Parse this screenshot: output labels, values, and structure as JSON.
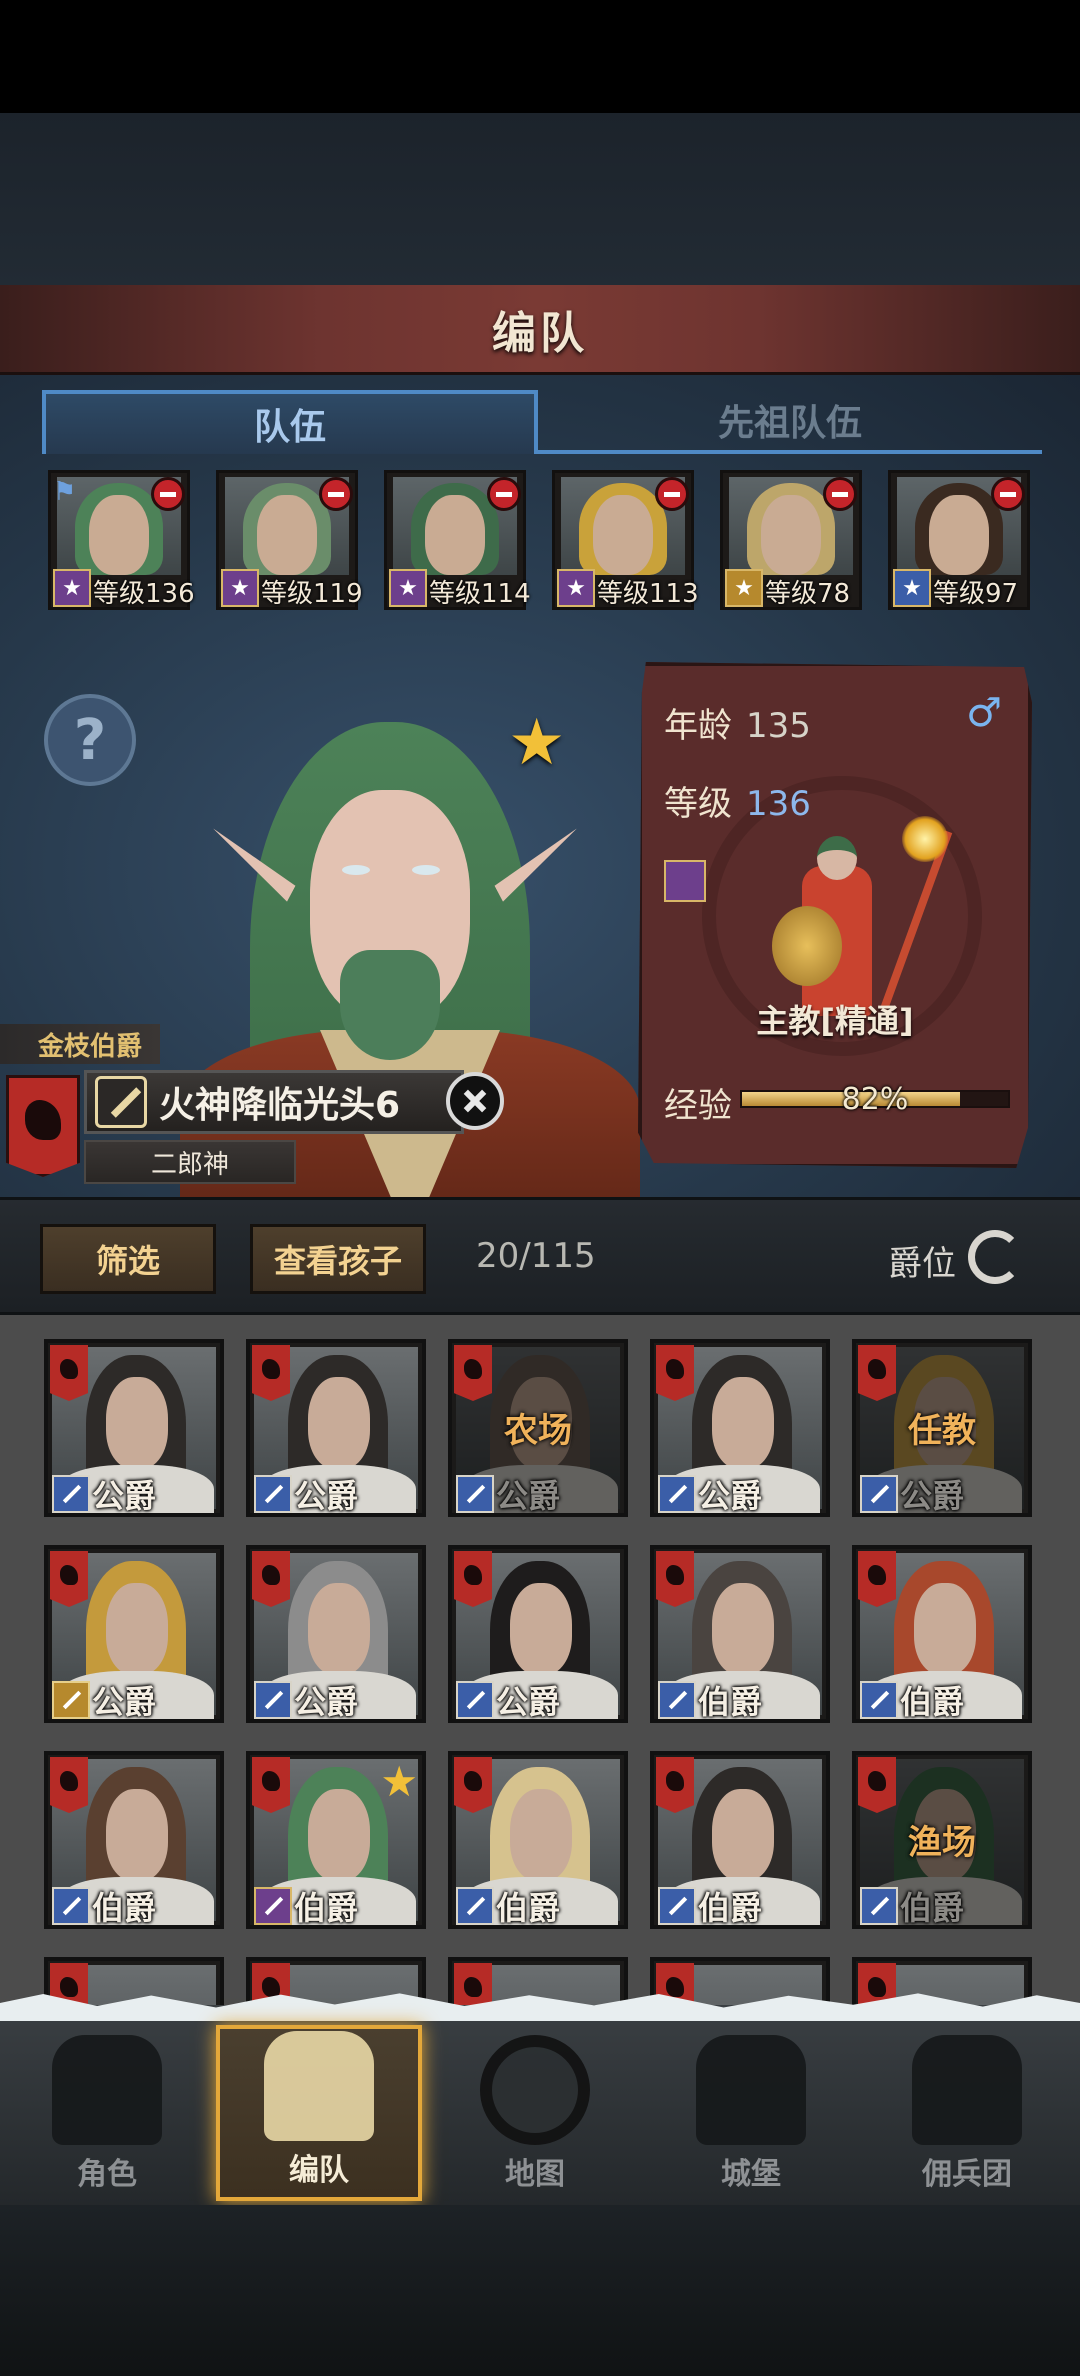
{
  "header": {
    "title": "编队"
  },
  "tabs": [
    {
      "label": "队伍",
      "active": true
    },
    {
      "label": "先祖队伍",
      "active": false
    }
  ],
  "team": [
    {
      "level": "等级136",
      "class": "purple",
      "hair": "#4d8258",
      "leader": true
    },
    {
      "level": "等级119",
      "class": "purple",
      "hair": "#6a8d6a"
    },
    {
      "level": "等级114",
      "class": "purple",
      "hair": "#3e6b4a"
    },
    {
      "level": "等级113",
      "class": "purple",
      "hair": "#c9a23a"
    },
    {
      "level": "等级78",
      "class": "gold",
      "hair": "#bda66a"
    },
    {
      "level": "等级97",
      "class": "blue",
      "hair": "#3a2a20"
    }
  ],
  "hero": {
    "title": "金枝伯爵",
    "name": "火神降临光头6",
    "subname": "二郎神"
  },
  "info": {
    "age_label": "年龄",
    "age": "135",
    "level_label": "等级",
    "level": "136",
    "class_name": "主教[精通]",
    "exp_label": "经验",
    "exp_percent": "82%",
    "exp_fraction": 0.82
  },
  "filter_bar": {
    "filter_label": "筛选",
    "children_label": "查看孩子",
    "count": "20/115",
    "sort_label": "爵位"
  },
  "roster": [
    {
      "rank": "公爵",
      "hair": "#2d2a28",
      "class": "blue"
    },
    {
      "rank": "公爵",
      "hair": "#2d2a28",
      "class": "blue"
    },
    {
      "rank": "公爵",
      "hair": "#6a5e55",
      "class": "blue",
      "job": "农场"
    },
    {
      "rank": "公爵",
      "hair": "#2d2a28",
      "class": "blue"
    },
    {
      "rank": "公爵",
      "hair": "#c7a04a",
      "class": "blue",
      "job": "任教"
    },
    {
      "rank": "公爵",
      "hair": "#c49a3c",
      "class": "gold"
    },
    {
      "rank": "公爵",
      "hair": "#8c8c8c",
      "class": "blue"
    },
    {
      "rank": "公爵",
      "hair": "#1e1c1c",
      "class": "blue"
    },
    {
      "rank": "伯爵",
      "hair": "#4a4440",
      "class": "blue"
    },
    {
      "rank": "伯爵",
      "hair": "#a8482c",
      "class": "blue"
    },
    {
      "rank": "伯爵",
      "hair": "#5a4030",
      "class": "blue"
    },
    {
      "rank": "伯爵",
      "hair": "#4d8258",
      "class": "purple",
      "star": true
    },
    {
      "rank": "伯爵",
      "hair": "#d6c28e",
      "class": "blue"
    },
    {
      "rank": "伯爵",
      "hair": "#2d2a28",
      "class": "blue"
    },
    {
      "rank": "伯爵",
      "hair": "#3e6b4a",
      "class": "blue",
      "job": "渔场"
    }
  ],
  "nav": [
    {
      "label": "角色",
      "icon": "knight-icon",
      "active": false
    },
    {
      "label": "编队",
      "icon": "helmet-icon",
      "active": true
    },
    {
      "label": "地图",
      "icon": "compass-map-icon",
      "active": false
    },
    {
      "label": "城堡",
      "icon": "castle-icon",
      "active": false
    },
    {
      "label": "佣兵团",
      "icon": "mercenary-icon",
      "active": false
    }
  ]
}
